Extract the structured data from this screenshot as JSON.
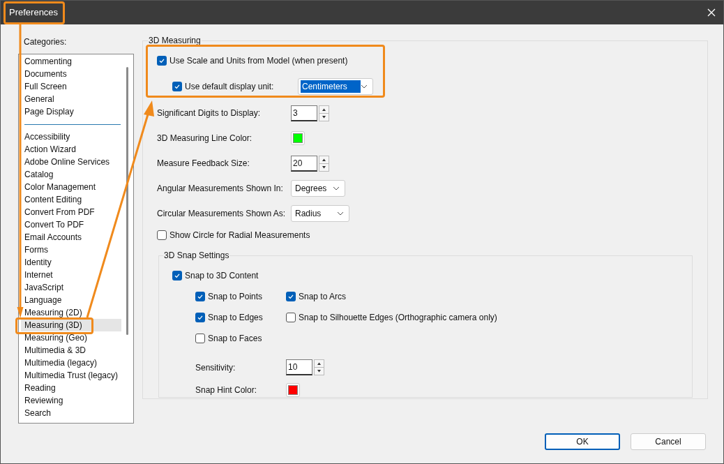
{
  "window": {
    "title": "Preferences"
  },
  "categories": {
    "label": "Categories:",
    "groups": [
      [
        {
          "label": "Commenting",
          "selected": false
        },
        {
          "label": "Documents",
          "selected": false
        },
        {
          "label": "Full Screen",
          "selected": false
        },
        {
          "label": "General",
          "selected": false
        },
        {
          "label": "Page Display",
          "selected": false
        }
      ],
      [
        {
          "label": "Accessibility",
          "selected": false
        },
        {
          "label": "Action Wizard",
          "selected": false
        },
        {
          "label": "Adobe Online Services",
          "selected": false
        },
        {
          "label": "Catalog",
          "selected": false
        },
        {
          "label": "Color Management",
          "selected": false
        },
        {
          "label": "Content Editing",
          "selected": false
        },
        {
          "label": "Convert From PDF",
          "selected": false
        },
        {
          "label": "Convert To PDF",
          "selected": false
        },
        {
          "label": "Email Accounts",
          "selected": false
        },
        {
          "label": "Forms",
          "selected": false
        },
        {
          "label": "Identity",
          "selected": false
        },
        {
          "label": "Internet",
          "selected": false
        },
        {
          "label": "JavaScript",
          "selected": false
        },
        {
          "label": "Language",
          "selected": false
        },
        {
          "label": "Measuring (2D)",
          "selected": false
        },
        {
          "label": "Measuring (3D)",
          "selected": true
        },
        {
          "label": "Measuring (Geo)",
          "selected": false
        },
        {
          "label": "Multimedia & 3D",
          "selected": false
        },
        {
          "label": "Multimedia (legacy)",
          "selected": false
        },
        {
          "label": "Multimedia Trust (legacy)",
          "selected": false
        },
        {
          "label": "Reading",
          "selected": false
        },
        {
          "label": "Reviewing",
          "selected": false
        },
        {
          "label": "Search",
          "selected": false
        }
      ]
    ]
  },
  "measuring": {
    "title": "3D Measuring",
    "use_model_units": {
      "label": "Use Scale and Units from Model (when present)",
      "checked": true
    },
    "default_unit": {
      "label": "Use default display unit:",
      "checked": true,
      "value": "Centimeters",
      "focused": true
    },
    "fields": [
      {
        "kind": "spinner",
        "label": "Significant Digits to Display:",
        "value": "3"
      },
      {
        "kind": "color",
        "label": "3D Measuring Line Color:",
        "color": "#00ff00"
      },
      {
        "kind": "spinner",
        "label": "Measure Feedback Size:",
        "value": "20"
      },
      {
        "kind": "dropdown",
        "label": "Angular Measurements Shown In:",
        "value": "Degrees"
      },
      {
        "kind": "dropdown",
        "label": "Circular Measurements Shown As:",
        "value": "Radius"
      }
    ],
    "show_circle": {
      "label": "Show Circle for Radial Measurements",
      "checked": false
    },
    "snap": {
      "title": "3D Snap Settings",
      "snap_content": {
        "label": "Snap to 3D Content",
        "checked": true
      },
      "options": [
        {
          "label": "Snap to Points",
          "checked": true
        },
        {
          "label": "Snap to Arcs",
          "checked": true
        },
        {
          "label": "Snap to Edges",
          "checked": true
        },
        {
          "label": "Snap to Silhouette Edges (Orthographic camera only)",
          "checked": false
        },
        {
          "label": "Snap to Faces",
          "checked": false
        }
      ],
      "sensitivity": {
        "label": "Sensitivity:",
        "value": "10"
      },
      "hint_color": {
        "label": "Snap Hint Color:",
        "color": "#ff0000"
      }
    }
  },
  "buttons": [
    {
      "label": "OK",
      "default": true
    },
    {
      "label": "Cancel",
      "default": false
    }
  ]
}
